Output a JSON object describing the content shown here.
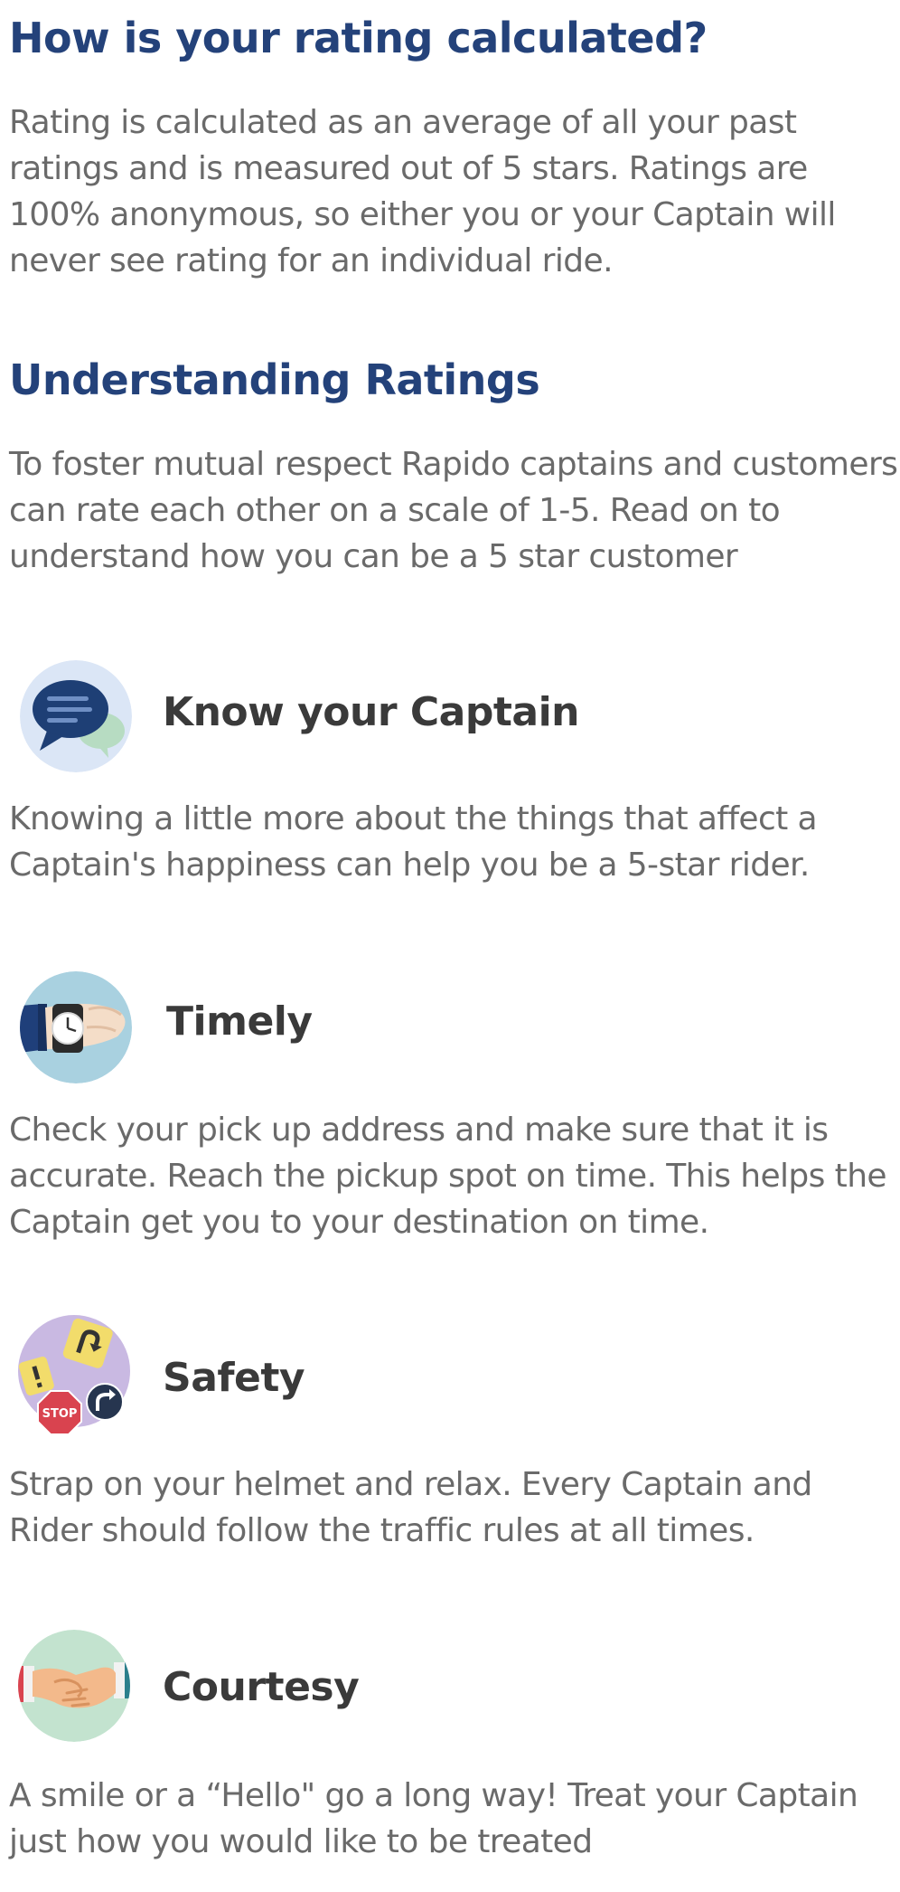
{
  "rating_section": {
    "heading": "How is your rating calculated?",
    "body": "Rating is calculated as an average of all your past ratings and is measured out of 5 stars. Ratings are 100% anonymous, so either you or your Captain will never see rating for an individual ride."
  },
  "understanding_section": {
    "heading": "Understanding Ratings",
    "body": "To foster mutual respect Rapido captains and customers can rate each other on a scale of 1-5. Read on to understand how you can be a 5 star customer"
  },
  "features": [
    {
      "title": "Know your Captain",
      "icon": "chat-bubbles-icon",
      "body": "Knowing a little more about the things that affect a Captain's happiness can help you be a 5-star rider."
    },
    {
      "title": "Timely",
      "icon": "wristwatch-icon",
      "body": "Check your pick up address and make sure that it is accurate. Reach the pickup spot on time. This helps the Captain get you to your destination on time."
    },
    {
      "title": "Safety",
      "icon": "traffic-signs-icon",
      "icon_text": "STOP",
      "body": "Strap on your helmet and relax. Every Captain and Rider should follow the traffic rules at all times."
    },
    {
      "title": "Courtesy",
      "icon": "handshake-icon",
      "body": "A smile or a “Hello\"  go a long way!  Treat your Captain just how you would like to be treated"
    }
  ],
  "colors": {
    "heading": "#24427a",
    "body_text": "#6a6a6a",
    "feature_title": "#3a3a3a",
    "background": "#ffffff"
  }
}
